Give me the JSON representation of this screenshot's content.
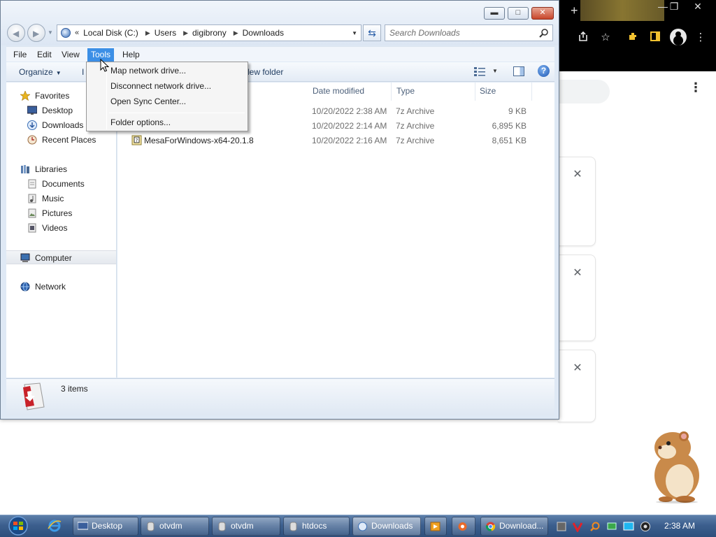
{
  "explorer": {
    "address": {
      "overflow_glyph": "«",
      "crumbs": [
        "Local Disk (C:)",
        "Users",
        "digibrony",
        "Downloads"
      ]
    },
    "search_placeholder": "Search Downloads",
    "menus": [
      "File",
      "Edit",
      "View",
      "Tools",
      "Help"
    ],
    "active_menu": "Tools",
    "commands": {
      "organize": "Organize",
      "include_partial": "I",
      "new_folder_partial": "lew folder"
    },
    "tools_menu": [
      "Map network drive...",
      "Disconnect network drive...",
      "Open Sync Center...",
      "Folder options..."
    ],
    "columns": {
      "date": "Date modified",
      "type": "Type",
      "size": "Size"
    },
    "files": [
      {
        "name": "",
        "date": "10/20/2022 2:38 AM",
        "type": "7z Archive",
        "size": "9 KB"
      },
      {
        "name": "",
        "date": "10/20/2022 2:14 AM",
        "type": "7z Archive",
        "size": "6,895 KB"
      },
      {
        "name": "MesaForWindows-x64-20.1.8",
        "date": "10/20/2022 2:16 AM",
        "type": "7z Archive",
        "size": "8,651 KB"
      }
    ],
    "nav": {
      "favorites": "Favorites",
      "desktop": "Desktop",
      "downloads": "Downloads",
      "recent": "Recent Places",
      "libraries": "Libraries",
      "documents": "Documents",
      "music": "Music",
      "pictures": "Pictures",
      "videos": "Videos",
      "computer": "Computer",
      "network": "Network"
    },
    "status": "3 items",
    "caption_buttons": {
      "minimize": "▬",
      "maximize": "□",
      "close": "✕"
    }
  },
  "chrome": {
    "new_tab": "+",
    "win_controls": [
      "—",
      "❐",
      "✕"
    ],
    "download_close": "✕",
    "menu_glyph": "⋮",
    "toolbar_icons": [
      "share-icon",
      "star-icon",
      "extensions-icon",
      "sidebar-icon",
      "profile-icon",
      "menu-icon"
    ]
  },
  "taskbar": {
    "buttons": [
      {
        "label": "Desktop",
        "icon": "desktop-icon"
      },
      {
        "label": "otvdm",
        "icon": "window-icon"
      },
      {
        "label": "otvdm",
        "icon": "window-icon"
      },
      {
        "label": "htdocs",
        "icon": "folder-icon"
      },
      {
        "label": "Downloads",
        "icon": "explorer-icon"
      },
      {
        "label": "",
        "icon": "media-icon"
      },
      {
        "label": "",
        "icon": "app-icon"
      },
      {
        "label": "Download...",
        "icon": "chrome-icon"
      }
    ],
    "clock": "2:38 AM"
  },
  "colors": {
    "menu_highlight": "#3c8fe6",
    "taskbar": "#3c5f8e",
    "window_frame": "#dfe9f5",
    "chrome_dark": "#000000",
    "extension_yellow": "#f2c230"
  }
}
